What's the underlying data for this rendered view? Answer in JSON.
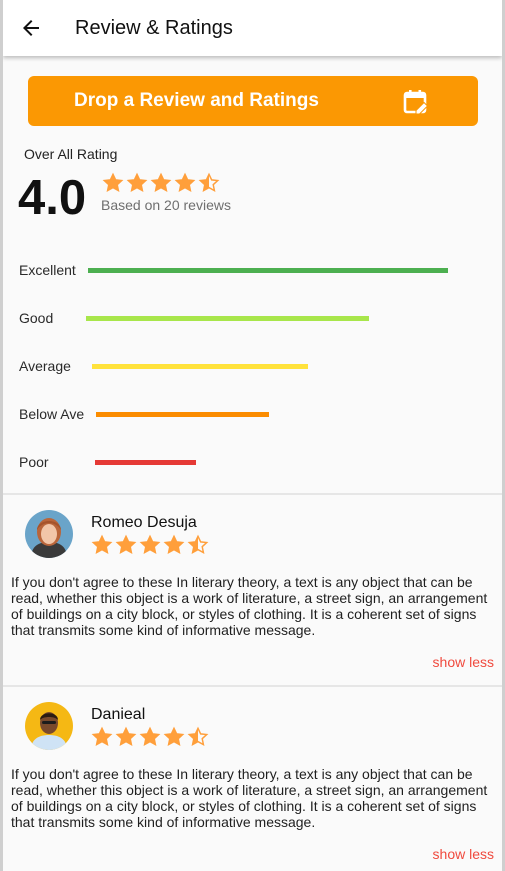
{
  "appbar": {
    "title": "Review & Ratings",
    "back_icon": "arrow-left-icon"
  },
  "cta": {
    "label": "Drop a Review and Ratings",
    "icon": "calendar-edit-icon",
    "color": "#fb9803"
  },
  "summary": {
    "label": "Over All Rating",
    "rating": "4.0",
    "stars": 4.5,
    "based_on": "Based on 20 reviews",
    "star_color": "#ff9f3b"
  },
  "breakdown": [
    {
      "label": "Excellent",
      "fraction": 0.75,
      "color": "#4caf50"
    },
    {
      "label": "Good",
      "fraction": 0.59,
      "color": "#a8e64b"
    },
    {
      "label": "Average",
      "fraction": 0.45,
      "color": "#ffe23b"
    },
    {
      "label": "Below Ave",
      "fraction": 0.36,
      "color": "#fb8c00"
    },
    {
      "label": "Poor",
      "fraction": 0.21,
      "color": "#e53935"
    }
  ],
  "reviews": [
    {
      "name": "Romeo Desuja",
      "stars": 4.5,
      "text": "If you don't agree to these In literary theory, a text is any object that can be read, whether this object is a work of literature, a street sign, an arrangement of buildings on a city block, or styles of clothing. It is a coherent set of signs that transmits some kind of informative message.",
      "toggle": "show less"
    },
    {
      "name": "Danieal",
      "stars": 4.5,
      "text": "If you don't agree to these In literary theory, a text is any object that can be read, whether this object is a work of literature, a street sign, an arrangement of buildings on a city block, or styles of clothing. It is a coherent set of signs that transmits some kind of informative message.",
      "toggle": "show less"
    }
  ]
}
